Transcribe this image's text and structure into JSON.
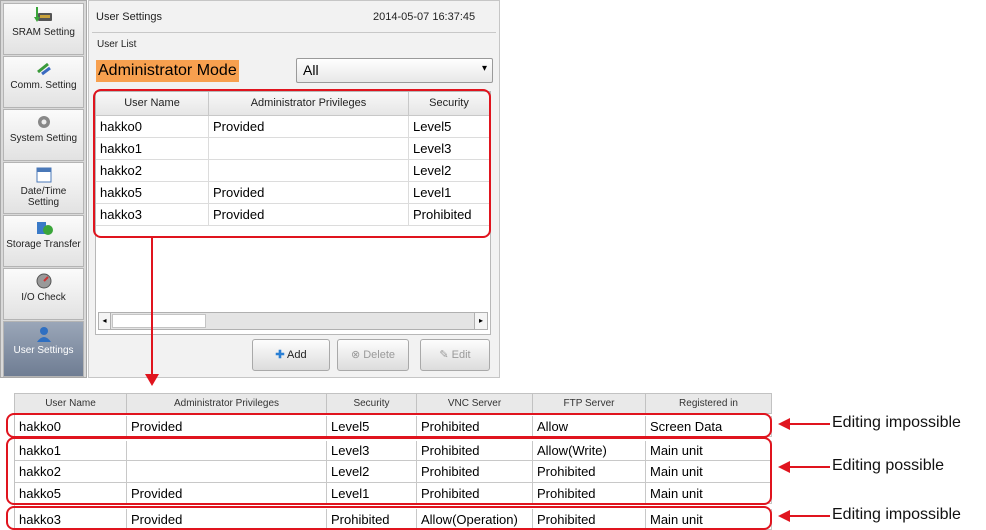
{
  "sidebar": {
    "items": [
      {
        "label": "SRAM Setting",
        "icon": "sram-icon"
      },
      {
        "label": "Comm. Setting",
        "icon": "comm-icon"
      },
      {
        "label": "System Setting",
        "icon": "gear-icon"
      },
      {
        "label": "Date/Time Setting",
        "icon": "calendar-icon"
      },
      {
        "label": "Storage Transfer",
        "icon": "storage-icon"
      },
      {
        "label": "I/O Check",
        "icon": "gauge-icon"
      },
      {
        "label": "User Settings",
        "icon": "user-icon"
      }
    ]
  },
  "header": {
    "title": "User Settings",
    "datetime": "2014-05-07  16:37:45"
  },
  "section_label": "User List",
  "mode_label": "Administrator Mode",
  "mode_select": {
    "value": "All"
  },
  "user_table": {
    "columns": [
      "User Name",
      "Administrator Privileges",
      "Security"
    ],
    "rows": [
      [
        "hakko0",
        "Provided",
        "Level5"
      ],
      [
        "hakko1",
        "",
        "Level3"
      ],
      [
        "hakko2",
        "",
        "Level2"
      ],
      [
        "hakko5",
        "Provided",
        "Level1"
      ],
      [
        "hakko3",
        "Provided",
        "Prohibited"
      ]
    ]
  },
  "buttons": {
    "add": "Add",
    "delete": "Delete",
    "edit": "Edit"
  },
  "detail_table": {
    "columns": [
      "User Name",
      "Administrator Privileges",
      "Security",
      "VNC Server",
      "FTP Server",
      "Registered in"
    ],
    "rows": [
      [
        "hakko0",
        "Provided",
        "Level5",
        "Prohibited",
        "Allow",
        "Screen Data"
      ],
      [
        "hakko1",
        "",
        "Level3",
        "Prohibited",
        "Allow(Write)",
        "Main unit"
      ],
      [
        "hakko2",
        "",
        "Level2",
        "Prohibited",
        "Prohibited",
        "Main unit"
      ],
      [
        "hakko5",
        "Provided",
        "Level1",
        "Prohibited",
        "Prohibited",
        "Main unit"
      ],
      [
        "hakko3",
        "Provided",
        "Prohibited",
        "Allow(Operation)",
        "Prohibited",
        "Main unit"
      ]
    ]
  },
  "annotations": {
    "first": "Editing impossible",
    "second": "Editing possible",
    "third": "Editing impossible"
  },
  "colors": {
    "highlight": "#e0141e",
    "mode_label_bg": "#f7a04f",
    "active_tab": "#7a879b"
  }
}
